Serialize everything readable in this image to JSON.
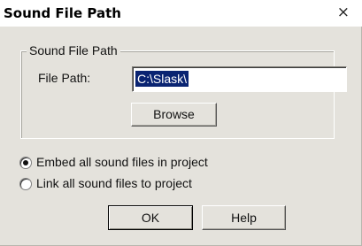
{
  "window": {
    "title": "Sound File Path",
    "close_glyph": "×"
  },
  "group": {
    "label": "Sound File Path"
  },
  "file_path": {
    "label": "File Path:",
    "value": "C:\\Slask\\"
  },
  "buttons": {
    "browse": "Browse",
    "ok": "OK",
    "help": "Help"
  },
  "options": [
    {
      "label": "Embed all sound files in project",
      "selected": true
    },
    {
      "label": "Link all sound files to project",
      "selected": false
    }
  ]
}
